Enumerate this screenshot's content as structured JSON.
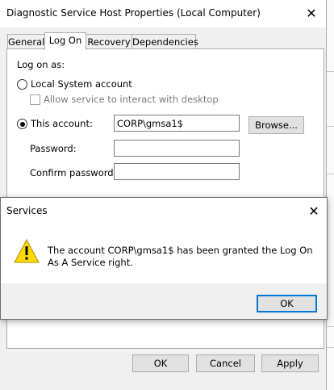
{
  "properties_window": {
    "title": "Diagnostic Service Host Properties (Local Computer)",
    "close_glyph": "✕",
    "tabs": [
      {
        "label": "General",
        "active": false
      },
      {
        "label": "Log On",
        "active": true
      },
      {
        "label": "Recovery",
        "active": false
      },
      {
        "label": "Dependencies",
        "active": false
      }
    ],
    "logon": {
      "heading": "Log on as:",
      "local_system_label": "Local System account",
      "interact_desktop_label": "Allow service to interact with desktop",
      "this_account_label": "This account:",
      "account_value": "CORP\\gmsa1$",
      "browse_label": "Browse...",
      "password_label": "Password:",
      "password_value": "",
      "confirm_password_label": "Confirm password:",
      "confirm_password_value": ""
    },
    "buttons": {
      "ok": "OK",
      "cancel": "Cancel",
      "apply": "Apply"
    }
  },
  "services_dialog": {
    "title": "Services",
    "close_glyph": "✕",
    "message": "The account CORP\\gmsa1$ has been granted the Log On As A Service right.",
    "ok_label": "OK",
    "icon": "warning-icon"
  },
  "colors": {
    "accent": "#0078d7",
    "warning_yellow": "#ffd800"
  }
}
